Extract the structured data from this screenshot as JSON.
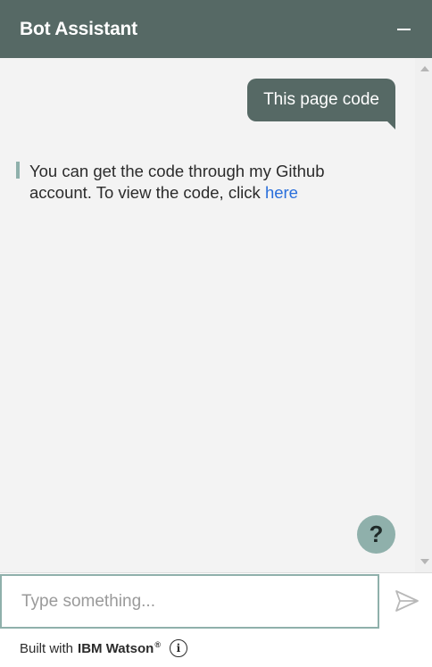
{
  "header": {
    "title": "Bot Assistant",
    "minimize_icon": "minimize-icon"
  },
  "conversation": {
    "user_message": "This page code",
    "bot_message_text": "You can get the code through my Github account. To view the code, click ",
    "bot_message_link": "here",
    "help_label": "?"
  },
  "input": {
    "placeholder": "Type something...",
    "value": "",
    "send_icon": "send-icon"
  },
  "footer": {
    "built_with": "Built with",
    "brand": "IBM Watson",
    "registered": "®",
    "info_label": "i"
  },
  "colors": {
    "header": "#566965",
    "accent": "#8fb0ab",
    "link": "#2a6fdb",
    "conversation_bg": "#f3f3f3"
  }
}
